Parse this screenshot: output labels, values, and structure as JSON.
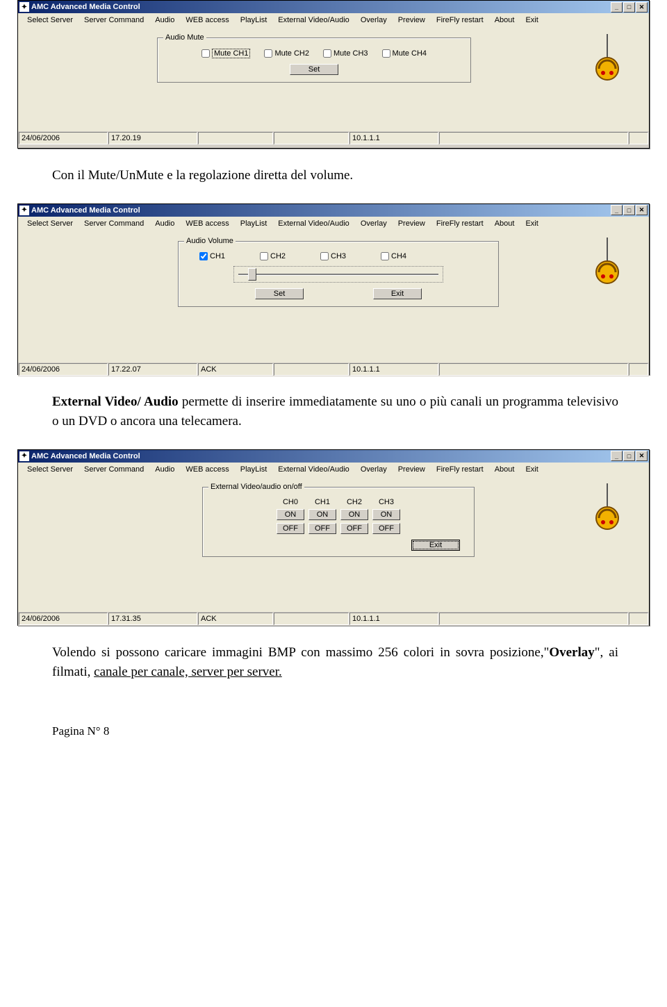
{
  "app": {
    "title": "AMC Advanced Media Control",
    "menu": [
      "Select Server",
      "Server Command",
      "Audio",
      "WEB access",
      "PlayList",
      "External Video/Audio",
      "Overlay",
      "Preview",
      "FireFly restart",
      "About",
      "Exit"
    ]
  },
  "win1": {
    "group_title": "Audio Mute",
    "checks": [
      {
        "label": "Mute CH1",
        "checked": false,
        "dashed": true
      },
      {
        "label": "Mute CH2",
        "checked": false
      },
      {
        "label": "Mute CH3",
        "checked": false
      },
      {
        "label": "Mute CH4",
        "checked": false
      }
    ],
    "set_btn": "Set",
    "status": {
      "date": "24/06/2006",
      "time": "17.20.19",
      "f3": "",
      "f4": "",
      "ip": "10.1.1.1",
      "f6": "",
      "f7": ""
    }
  },
  "paragraphs": {
    "p1": "Con il Mute/UnMute e la regolazione diretta del volume.",
    "p2a": "External Video/ Audio",
    "p2b": " permette di inserire immediatamente su uno o più canali un programma televisivo o un DVD o ancora una telecamera.",
    "p3a": "Volendo si possono caricare immagini BMP con massimo 256 colori in sovra posizione,\"",
    "p3b": "Overlay",
    "p3c": "\", ai filmati, ",
    "p3d": "canale per canale, server per server.",
    "footer": "Pagina N° 8"
  },
  "win2": {
    "group_title": "Audio Volume",
    "checks": [
      {
        "label": "CH1",
        "checked": true
      },
      {
        "label": "CH2",
        "checked": false
      },
      {
        "label": "CH3",
        "checked": false
      },
      {
        "label": "CH4",
        "checked": false
      }
    ],
    "set_btn": "Set",
    "exit_btn": "Exit",
    "status": {
      "date": "24/06/2006",
      "time": "17.22.07",
      "f3": "ACK",
      "f4": "",
      "ip": "10.1.1.1",
      "f6": "",
      "f7": ""
    }
  },
  "win3": {
    "group_title": "External Video/audio on/off",
    "cols": [
      "CH0",
      "CH1",
      "CH2",
      "CH3"
    ],
    "on": "ON",
    "off": "OFF",
    "exit_btn": "Exit",
    "status": {
      "date": "24/06/2006",
      "time": "17.31.35",
      "f3": "ACK",
      "f4": "",
      "ip": "10.1.1.1",
      "f6": "",
      "f7": ""
    }
  }
}
